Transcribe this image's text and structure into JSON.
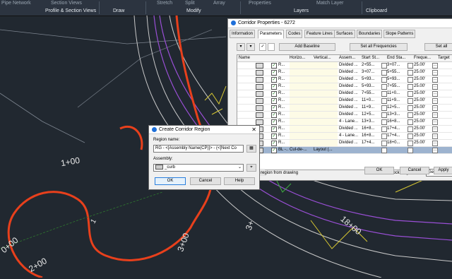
{
  "ribbon": {
    "tools": [
      "Pipe Network",
      "Section Views",
      "Stretch",
      "Split",
      "Array",
      "Properties",
      "Match Layer"
    ],
    "panels": [
      "Profile & Section Views",
      "Draw",
      "Modify",
      "Layers",
      "Clipboard"
    ]
  },
  "drawing": {
    "stations": [
      "1+00",
      "2+00",
      "0+00",
      "3+00",
      "3+",
      "18+00",
      "1"
    ]
  },
  "corridor_props": {
    "title": "Corridor Properties - 6272",
    "tabs": [
      "Information",
      "Parameters",
      "Codes",
      "Feature Lines",
      "Surfaces",
      "Boundaries",
      "Slope Patterns"
    ],
    "active_tab": "Parameters",
    "add_baseline": "Add Baseline",
    "set_all_frequencies": "Set all Frequencies",
    "set_all": "Set all",
    "columns": [
      "Name",
      "Horizo...",
      "Vertical...",
      "Assem...",
      "Start St...",
      "End Sta...",
      "Freque...",
      "Target"
    ],
    "rows": [
      {
        "name": "R...",
        "asm": "Divided ...",
        "start": "2+55...",
        "end": "3+07...",
        "freq": "25.00'"
      },
      {
        "name": "R...",
        "asm": "Divided ...",
        "start": "3+07...",
        "end": "5+55...",
        "freq": "25.00'"
      },
      {
        "name": "R...",
        "asm": "Divided ...",
        "start": "5+93...",
        "end": "5+93...",
        "freq": "25.00'"
      },
      {
        "name": "R...",
        "asm": "Divided ...",
        "start": "5+93...",
        "end": "7+55...",
        "freq": "25.00'"
      },
      {
        "name": "R...",
        "asm": "Divided ...",
        "start": "7+55...",
        "end": "11+0...",
        "freq": "25.00'"
      },
      {
        "name": "R...",
        "asm": "Divided ...",
        "start": "11+0...",
        "end": "11+9...",
        "freq": "25.00'"
      },
      {
        "name": "R...",
        "asm": "Divided ...",
        "start": "11+9...",
        "end": "12+5...",
        "freq": "25.00'"
      },
      {
        "name": "R...",
        "asm": "Divided ...",
        "start": "12+5...",
        "end": "13+3...",
        "freq": "25.00'"
      },
      {
        "name": "R...",
        "asm": "4 - Lane...",
        "start": "13+3...",
        "end": "16+8...",
        "freq": "25.00'"
      },
      {
        "name": "R...",
        "asm": "Divided ...",
        "start": "16+8...",
        "end": "17+4...",
        "freq": "25.00'"
      },
      {
        "name": "R...",
        "asm": "4 - Lane...",
        "start": "16+8...",
        "end": "17+4...",
        "freq": "25.00'"
      },
      {
        "name": "R...",
        "asm": "Divided ...",
        "start": "17+4...",
        "end": "18+0...",
        "freq": "25.00'"
      },
      {
        "name": "BL -...",
        "horiz": "Cul-de-...",
        "vert": "Layout (...",
        "asm": "",
        "start": "",
        "end": "",
        "freq": "",
        "selected": true
      }
    ],
    "status_text": "region from drawing",
    "lock_regions_label": "Lock Regions To:",
    "lock_regions_value": "Geometry Locked",
    "ok": "OK",
    "cancel": "Cancel",
    "apply": "Apply"
  },
  "create_region": {
    "title": "Create Corridor Region",
    "region_name_label": "Region name:",
    "region_name_value": "RG - <[Assembly Name(CP)]> - (<[Next Co",
    "assembly_label": "Assembly:",
    "assembly_value": "_curb",
    "ok": "OK",
    "cancel": "Cancel",
    "help": "Help"
  },
  "colors": {
    "background": "#212830",
    "alignment": "#e8401c",
    "corridor": "#9a4fd6",
    "road_edge": "#c8c8c8",
    "feature": "#d8c832"
  }
}
